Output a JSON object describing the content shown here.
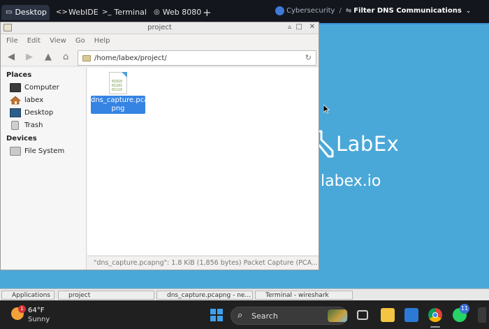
{
  "tabs": [
    {
      "label": "Desktop",
      "icon": "monitor-icon",
      "active": true
    },
    {
      "label": "WebIDE",
      "icon": "code-icon",
      "active": false
    },
    {
      "label": "Terminal",
      "icon": "terminal-icon",
      "active": false
    },
    {
      "label": "Web 8080",
      "icon": "globe-icon",
      "active": false
    }
  ],
  "breadcrumb": {
    "course": "Cybersecurity",
    "separator": "/",
    "lab": "Filter DNS Communications"
  },
  "desktop": {
    "brand": "LabEx",
    "url": "labex.io"
  },
  "window": {
    "title": "project",
    "menu": [
      "File",
      "Edit",
      "View",
      "Go",
      "Help"
    ],
    "path": "/home/labex/project/",
    "sidebar": {
      "places_heading": "Places",
      "places": [
        "Computer",
        "labex",
        "Desktop",
        "Trash"
      ],
      "devices_heading": "Devices",
      "devices": [
        "File System"
      ]
    },
    "file": {
      "name_line1": "dns_capture.pca",
      "name_line2": "png",
      "thumb_bits": [
        "01010",
        "01101",
        "01110"
      ]
    },
    "status": "\"dns_capture.pcapng\": 1.8 KiB (1,856 bytes) Packet Capture (PCA..."
  },
  "panel": {
    "items": [
      "Applications",
      "project",
      "dns_capture.pcapng - ne...",
      "Terminal - wireshark"
    ]
  },
  "taskbar": {
    "temperature": "64°F",
    "condition": "Sunny",
    "weather_badge": "1",
    "search_placeholder": "Search",
    "whatsapp_badge": "11"
  },
  "colors": {
    "desktop_bg": "#4aa8d8",
    "selection": "#3584e4",
    "topbar": "#13161c",
    "taskbar": "#202020"
  }
}
